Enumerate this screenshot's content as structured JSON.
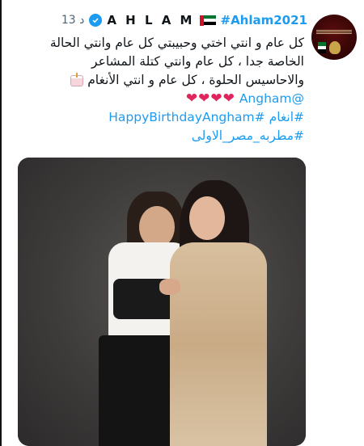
{
  "tweet": {
    "author_name": "A H L A M",
    "author_hashtag": "#Ahlam2021",
    "time": "13 د",
    "lines": [
      "كل عام و انتي اختي وحبيبتي كل عام وانتي الحالة",
      "الخاصة جدا ، كل عام وانتي كتلة المشاعر",
      "والاحاسيس الحلوة ، كل عام و انتي الأنغام"
    ],
    "mention": "@Angham",
    "hearts": "❤❤❤❤",
    "hashtag1": "#انغام",
    "hashtag2": "#HappyBirthdayAngham",
    "hashtag3": "#مطربه_مصر_الاولى"
  },
  "icons": {
    "avatar": "profile-avatar",
    "verified": "verified-badge-icon",
    "flag": "uae-flag-icon",
    "cake": "birthday-cake-emoji",
    "heart": "red-heart-emoji"
  },
  "colors": {
    "link": "#1d9bf0",
    "verified": "#1d9bf0",
    "heart": "#e0245e",
    "text": "#0f1419",
    "muted": "#536471"
  }
}
